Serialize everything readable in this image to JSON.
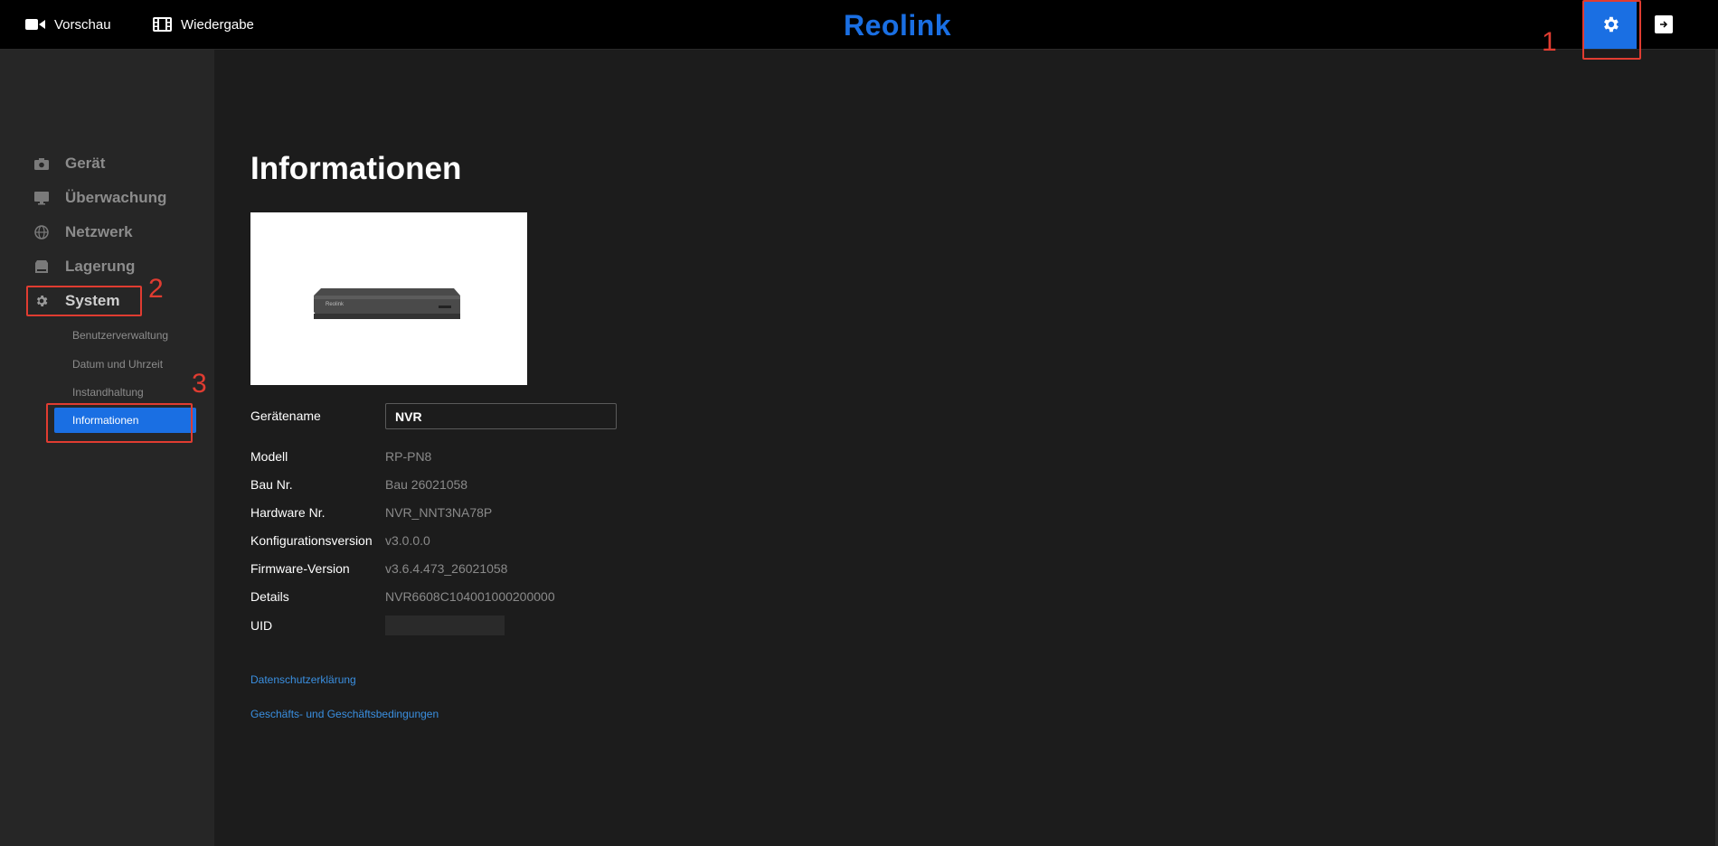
{
  "topbar": {
    "preview_label": "Vorschau",
    "playback_label": "Wiedergabe",
    "logo_text": "Reolink"
  },
  "sidebar": {
    "items": [
      {
        "label": "Gerät",
        "icon": "camera-icon"
      },
      {
        "label": "Überwachung",
        "icon": "monitor-icon"
      },
      {
        "label": "Netzwerk",
        "icon": "globe-icon"
      },
      {
        "label": "Lagerung",
        "icon": "storage-icon"
      },
      {
        "label": "System",
        "icon": "gear-icon"
      }
    ],
    "submenu": [
      {
        "label": "Benutzerverwaltung"
      },
      {
        "label": "Datum und Uhrzeit"
      },
      {
        "label": "Instandhaltung"
      },
      {
        "label": "Informationen"
      }
    ]
  },
  "main": {
    "title": "Informationen",
    "device_name_label": "Gerätename",
    "device_name_value": "NVR",
    "device_image_logo": "Reolink",
    "fields": [
      {
        "label": "Modell",
        "value": "RP-PN8"
      },
      {
        "label": "Bau Nr.",
        "value": "Bau 26021058"
      },
      {
        "label": "Hardware Nr.",
        "value": "NVR_NNT3NA78P"
      },
      {
        "label": "Konfigurationsversion",
        "value": "v3.0.0.0"
      },
      {
        "label": "Firmware-Version",
        "value": "v3.6.4.473_26021058"
      },
      {
        "label": "Details",
        "value": "NVR6608C104001000200000"
      },
      {
        "label": "UID",
        "value": ""
      }
    ],
    "links": {
      "privacy": "Datenschutzerklärung",
      "terms": "Geschäfts- und Geschäftsbedingungen"
    }
  },
  "annotations": {
    "one": "1",
    "two": "2",
    "three": "3"
  },
  "colors": {
    "accent": "#1a6fe3",
    "annotation": "#e03c31",
    "link": "#3a8fe0"
  }
}
